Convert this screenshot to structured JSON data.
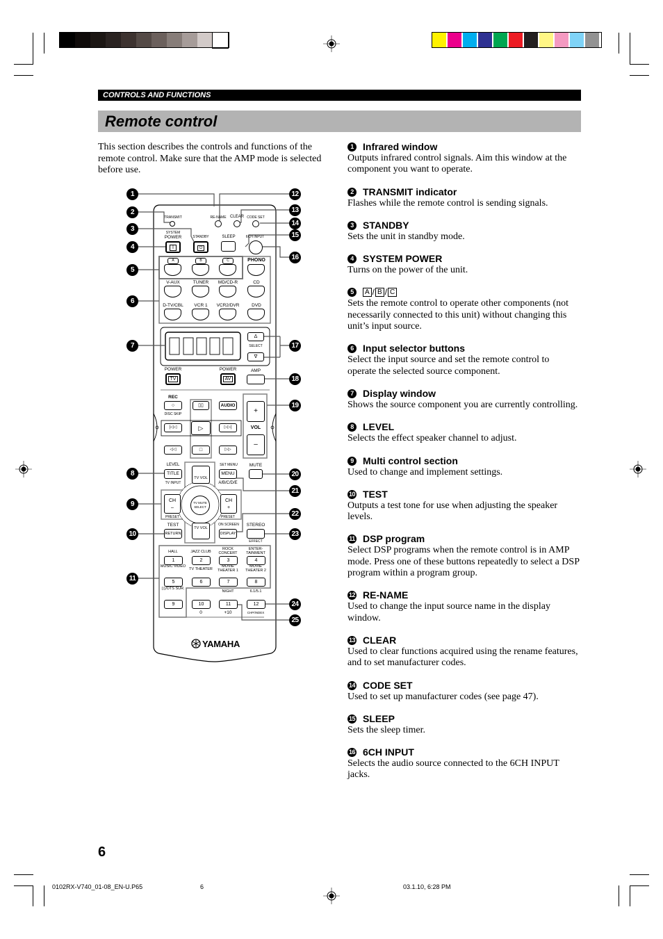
{
  "print_marks": {
    "grayscale_swatches": [
      "#000000",
      "#0f0b0a",
      "#1c1714",
      "#2a2321",
      "#3d3330",
      "#544a46",
      "#6b605c",
      "#877d79",
      "#a69c99",
      "#d2cac8",
      "#ffffff"
    ],
    "color_swatches": [
      "#fff200",
      "#ec008c",
      "#00aeef",
      "#2e3192",
      "#00a651",
      "#ed1c24",
      "#231f20",
      "#fff685",
      "#f49ac1",
      "#7fd3f7",
      "#929292"
    ]
  },
  "header": {
    "section": "CONTROLS AND FUNCTIONS",
    "title": "Remote control"
  },
  "intro": "This section describes the controls and functions of the remote control. Make sure that the AMP mode is selected before use.",
  "remote": {
    "brand": "YAMAHA",
    "labels": {
      "transmit": "TRANSMIT",
      "rename": "RE-NAME",
      "clear": "CLEAR",
      "code_set": "CODE SET",
      "system": "SYSTEM",
      "power": "POWER",
      "standby": "STANDBY",
      "sleep": "SLEEP",
      "six_ch_input": "6CH INPUT",
      "power_icon": "I",
      "standby_icon": "⏻",
      "a": "A",
      "b": "B",
      "c": "C",
      "phono": "PHONO",
      "vaux": "V-AUX",
      "tuner": "TUNER",
      "mdcdr": "MD/CD-R",
      "cd": "CD",
      "dtv": "D-TV/CBL",
      "vcr1": "VCR 1",
      "vcr2": "VCR2/DVR",
      "dvd": "DVD",
      "select": "SELECT",
      "up": "Δ",
      "down": "∇",
      "power_tv_label": "POWER",
      "tv": "TV",
      "power_av_label": "POWER",
      "av": "AV",
      "amp": "AMP",
      "rec": "REC",
      "rec_icon": "○",
      "disc_skip": "DISC SKIP",
      "pause": "▯▯",
      "audio": "AUDIO",
      "vol_plus": "+",
      "vol": "VOL",
      "vol_minus": "–",
      "skip_back": "|◁◁",
      "play": "▷",
      "skip_fwd": "▷▷|",
      "rew": "◁◁",
      "stop": "□",
      "ff": "▷▷",
      "level": "LEVEL",
      "title": "TITLE",
      "tv_input": "TV INPUT",
      "tv_vol_up": "TV VOL",
      "set_menu": "SET MENU",
      "menu": "MENU",
      "abcde": "A/B/C/D/E",
      "mute": "MUTE",
      "ch": "CH",
      "ch_minus": "–",
      "ch_plus": "+",
      "tv_mute": "TV MUTE",
      "select2": "SELECT",
      "preset": "PRESET",
      "test": "TEST",
      "return": "RETURN",
      "tv_vol_down": "TV VOL",
      "on_screen": "ON SCREEN",
      "display": "DISPLAY",
      "stereo": "STEREO",
      "effect": "EFFECT",
      "dsp": [
        {
          "label": "HALL",
          "num": "1"
        },
        {
          "label": "JAZZ CLUB",
          "num": "2"
        },
        {
          "label": "ROCK CONCERT",
          "num": "3"
        },
        {
          "label": "ENTER-TAINMENT",
          "num": "4"
        },
        {
          "label": "MUSIC VIDEO",
          "num": "5"
        },
        {
          "label": "TV THEATER",
          "num": "6"
        },
        {
          "label": "MOVIE THEATER 1",
          "num": "7"
        },
        {
          "label": "MOVIE THEATER 2",
          "num": "8"
        },
        {
          "label": "▯▯/DTS SUR.",
          "num": "9"
        },
        {
          "label": "",
          "num": "10",
          "sub": "0"
        },
        {
          "label": "NIGHT",
          "num": "11",
          "sub": "+10"
        },
        {
          "label": "6.1/5.1",
          "num": "12",
          "sub": "CHP/INDEX"
        }
      ]
    },
    "callouts": [
      "1",
      "2",
      "3",
      "4",
      "5",
      "6",
      "7",
      "8",
      "9",
      "10",
      "11",
      "12",
      "13",
      "14",
      "15",
      "16",
      "17",
      "18",
      "19",
      "20",
      "21",
      "22",
      "23",
      "24",
      "25"
    ]
  },
  "items": [
    {
      "n": "1",
      "title": "Infrared window",
      "body": "Outputs infrared control signals. Aim this window at the component you want to operate."
    },
    {
      "n": "2",
      "title": "TRANSMIT indicator",
      "body": "Flashes while the remote control is sending signals."
    },
    {
      "n": "3",
      "title": "STANDBY",
      "body": "Sets the unit in standby mode."
    },
    {
      "n": "4",
      "title": "SYSTEM POWER",
      "body": "Turns on the power of the unit."
    },
    {
      "n": "5",
      "title_boxes": [
        "A",
        "B",
        "C"
      ],
      "body": "Sets the remote control to operate other components (not necessarily connected to this unit) without changing this unit’s input source."
    },
    {
      "n": "6",
      "title": "Input selector buttons",
      "body": "Select the input source and set the remote control to operate the selected source component."
    },
    {
      "n": "7",
      "title": "Display window",
      "body": "Shows the source component you are currently controlling."
    },
    {
      "n": "8",
      "title": "LEVEL",
      "body": "Selects the effect speaker channel to adjust."
    },
    {
      "n": "9",
      "title": "Multi control section",
      "body": "Used to change and implement settings."
    },
    {
      "n": "10",
      "title": "TEST",
      "body": "Outputs a test tone for use when adjusting the speaker levels."
    },
    {
      "n": "11",
      "title": "DSP program",
      "body": "Select DSP programs when the remote control is in AMP mode. Press one of these buttons repeatedly to select a DSP program within a program group."
    },
    {
      "n": "12",
      "title": "RE-NAME",
      "body": "Used to change the input source name in the display window."
    },
    {
      "n": "13",
      "title": "CLEAR",
      "body": "Used to clear functions acquired using the rename features, and to set manufacturer codes."
    },
    {
      "n": "14",
      "title": "CODE SET",
      "body": "Used to set up manufacturer codes (see page 47)."
    },
    {
      "n": "15",
      "title": "SLEEP",
      "body": "Sets the sleep timer."
    },
    {
      "n": "16",
      "title": "6CH INPUT",
      "body": "Selects the audio source connected to the 6CH INPUT jacks."
    }
  ],
  "page_number": "6",
  "footer": {
    "file": "0102RX-V740_01-08_EN-U.P65",
    "page": "6",
    "date": "03.1.10, 6:28 PM"
  }
}
